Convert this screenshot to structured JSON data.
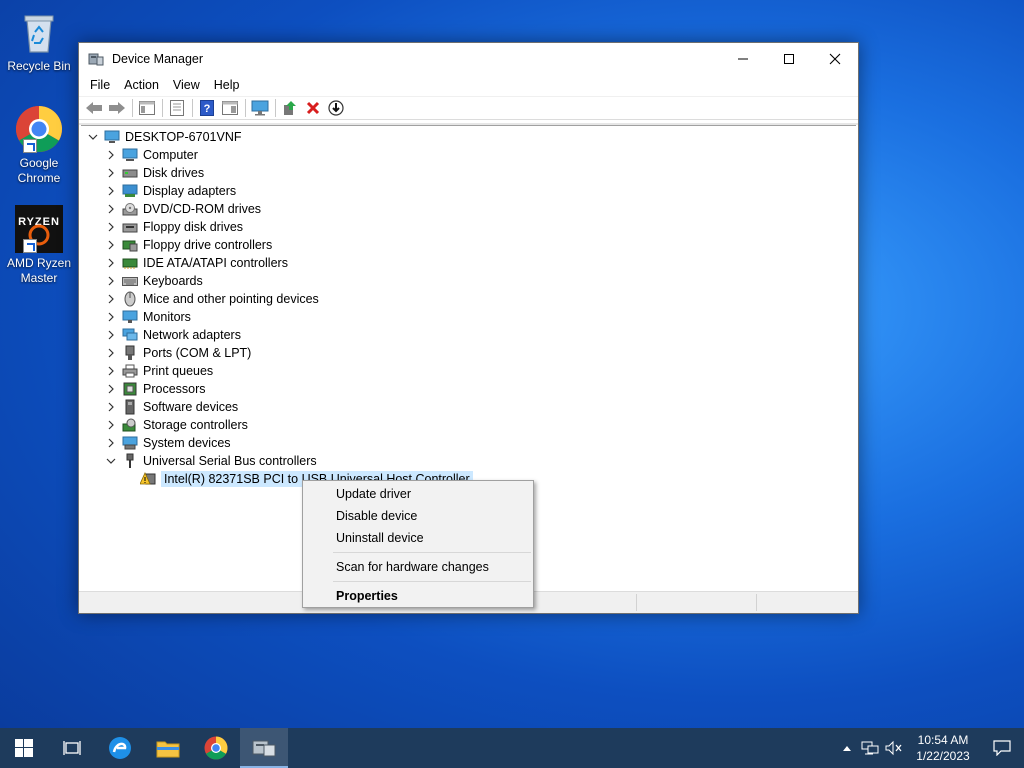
{
  "desktop": {
    "icons": [
      {
        "label": "Recycle Bin"
      },
      {
        "label": "Google Chrome"
      },
      {
        "label": "AMD Ryzen Master",
        "badge": "RYZEN"
      }
    ]
  },
  "window": {
    "title": "Device Manager",
    "menu": [
      "File",
      "Action",
      "View",
      "Help"
    ],
    "tree": {
      "root": "DESKTOP-6701VNF",
      "categories": [
        "Computer",
        "Disk drives",
        "Display adapters",
        "DVD/CD-ROM drives",
        "Floppy disk drives",
        "Floppy drive controllers",
        "IDE ATA/ATAPI controllers",
        "Keyboards",
        "Mice and other pointing devices",
        "Monitors",
        "Network adapters",
        "Ports (COM & LPT)",
        "Print queues",
        "Processors",
        "Software devices",
        "Storage controllers",
        "System devices",
        "Universal Serial Bus controllers"
      ],
      "expanded_child": "Intel(R) 82371SB PCI to USB Universal Host Controller"
    }
  },
  "context_menu": {
    "update_driver": "Update driver",
    "disable_device": "Disable device",
    "uninstall_device": "Uninstall device",
    "scan_hardware": "Scan for hardware changes",
    "properties": "Properties"
  },
  "taskbar": {
    "time": "10:54 AM",
    "date": "1/22/2023"
  },
  "colors": {
    "accent": "#0078d7",
    "selection": "#cce8ff",
    "taskbar": "#1e3b5c",
    "delete_red": "#d81e1e"
  }
}
